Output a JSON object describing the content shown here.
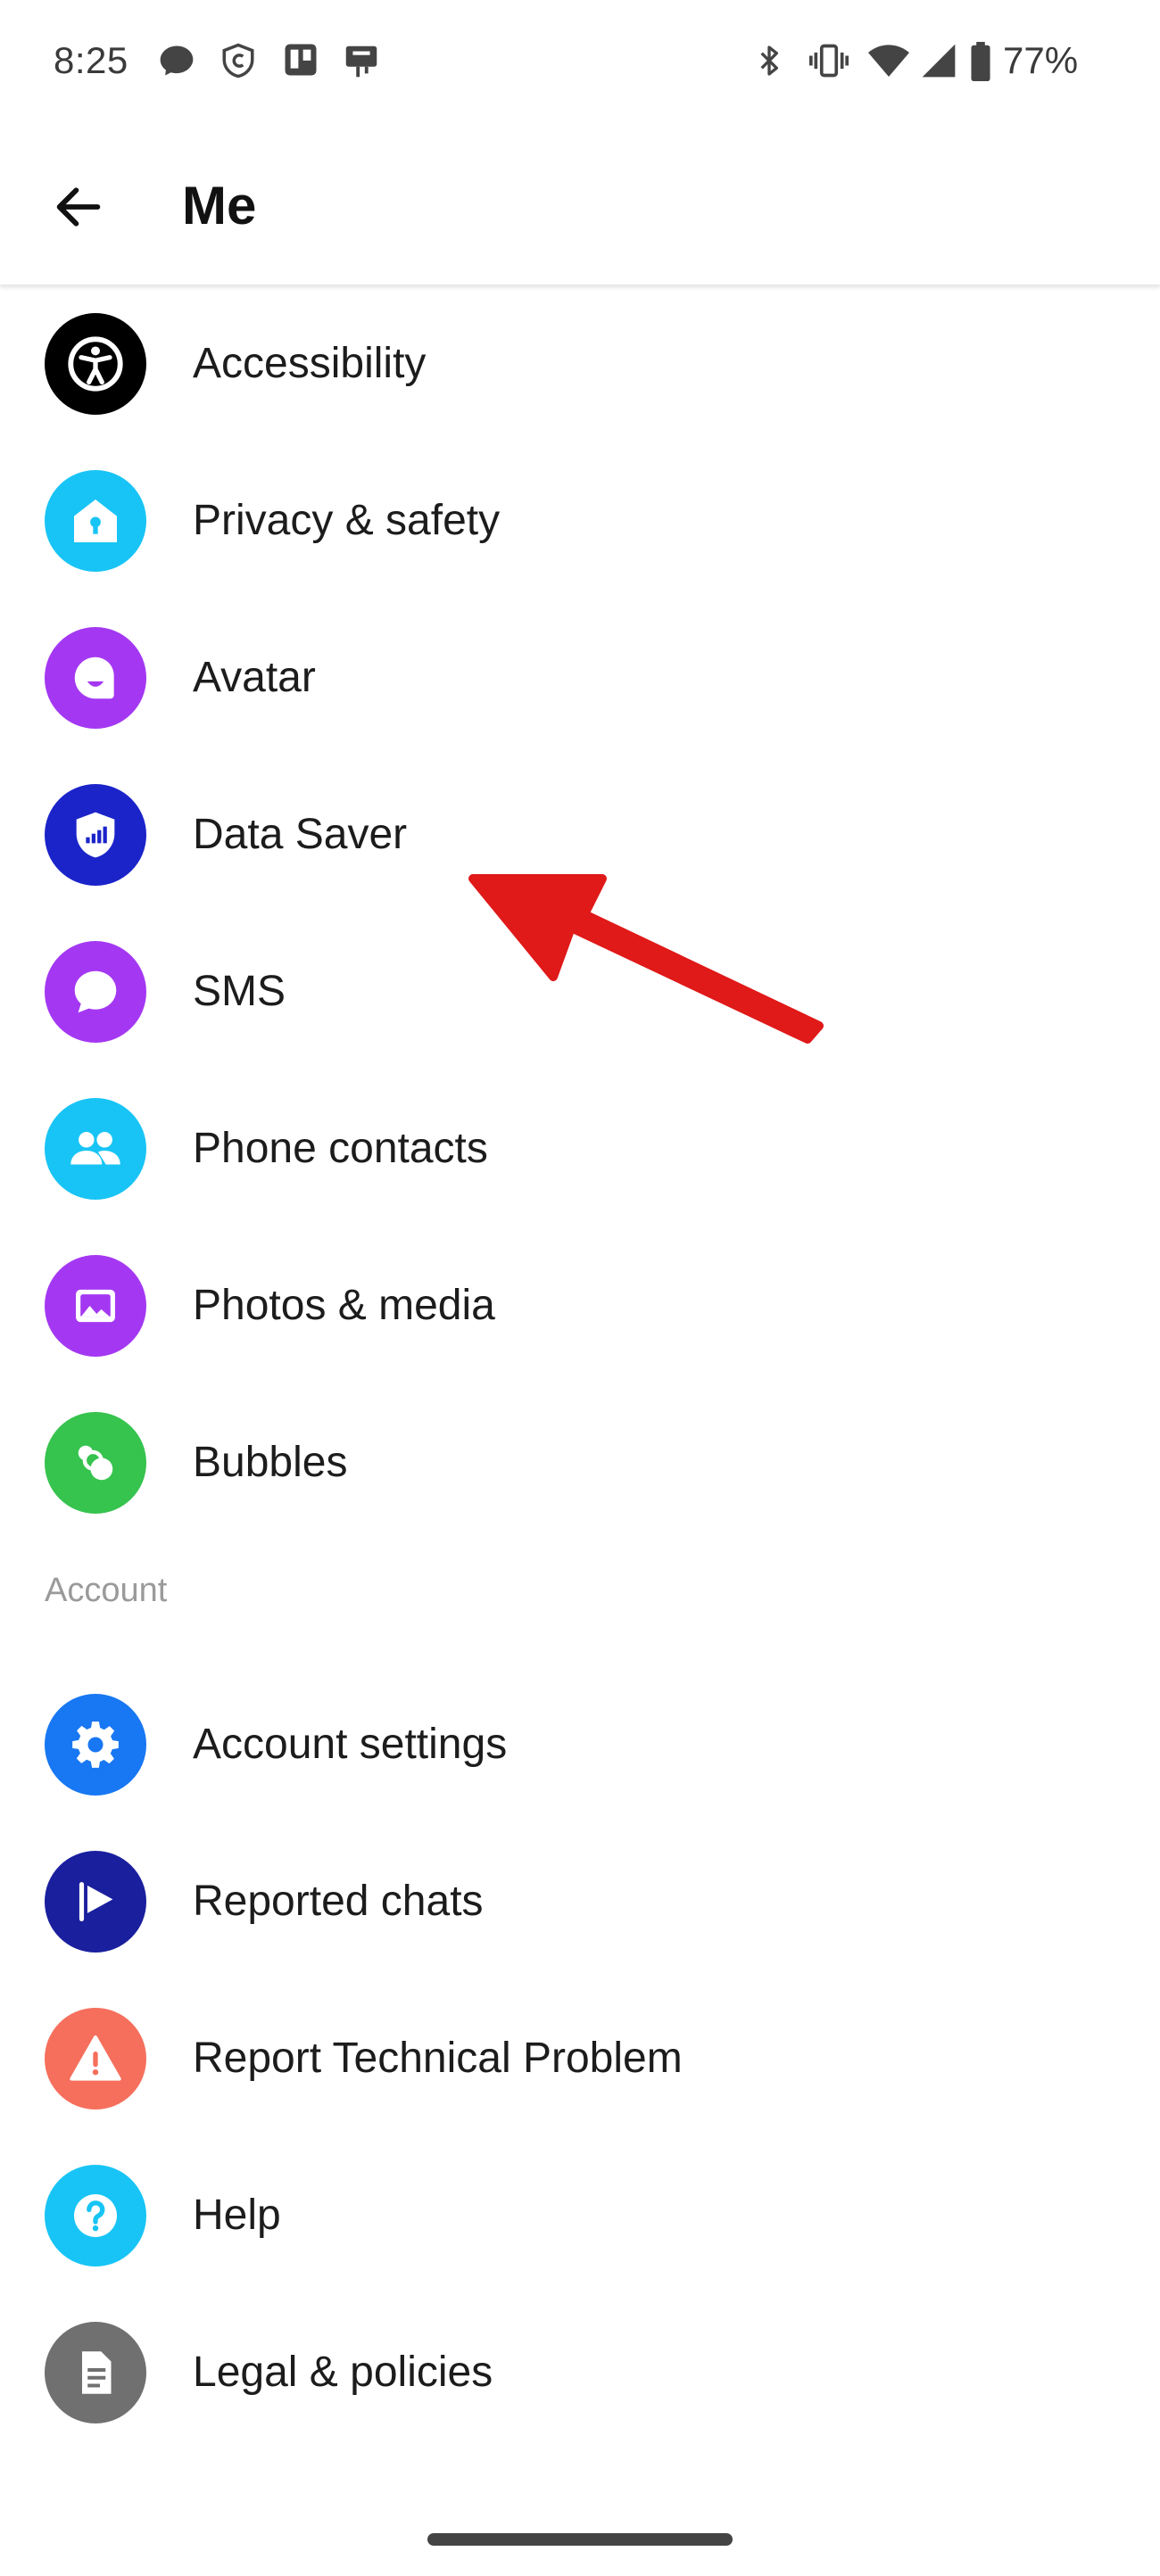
{
  "status_bar": {
    "time": "8:25",
    "battery_percent": "77%",
    "icons": [
      "chat-bubble-icon",
      "shield-c-icon",
      "trello-icon",
      "notification-icon",
      "bluetooth-icon",
      "vibrate-icon",
      "wifi-icon",
      "signal-icon",
      "battery-icon"
    ]
  },
  "header": {
    "title": "Me",
    "back_icon": "arrow-left-icon"
  },
  "list": {
    "items": [
      {
        "label": "Accessibility",
        "icon": "accessibility-icon",
        "color": "#000000"
      },
      {
        "label": "Privacy & safety",
        "icon": "house-lock-icon",
        "color": "#18C4F5"
      },
      {
        "label": "Avatar",
        "icon": "avatar-face-icon",
        "color": "#A438F2"
      },
      {
        "label": "Data Saver",
        "icon": "shield-signal-icon",
        "color": "#1B24C9"
      },
      {
        "label": "SMS",
        "icon": "chat-bubble-icon",
        "color": "#A438F2"
      },
      {
        "label": "Phone contacts",
        "icon": "people-icon",
        "color": "#18C4F5"
      },
      {
        "label": "Photos & media",
        "icon": "image-icon",
        "color": "#A438F2"
      },
      {
        "label": "Bubbles",
        "icon": "bubbles-icon",
        "color": "#36C34E"
      }
    ],
    "section_account": {
      "title": "Account",
      "items": [
        {
          "label": "Account settings",
          "icon": "gear-icon",
          "color": "#1877F2"
        },
        {
          "label": "Reported chats",
          "icon": "flag-icon",
          "color": "#1A1F9E"
        },
        {
          "label": "Report Technical Problem",
          "icon": "warning-icon",
          "color": "#F56F5C"
        },
        {
          "label": "Help",
          "icon": "question-icon",
          "color": "#18C4F5"
        },
        {
          "label": "Legal & policies",
          "icon": "document-icon",
          "color": "#707070"
        }
      ]
    }
  },
  "annotation": {
    "color": "#E01919",
    "points_to": "Data Saver"
  }
}
